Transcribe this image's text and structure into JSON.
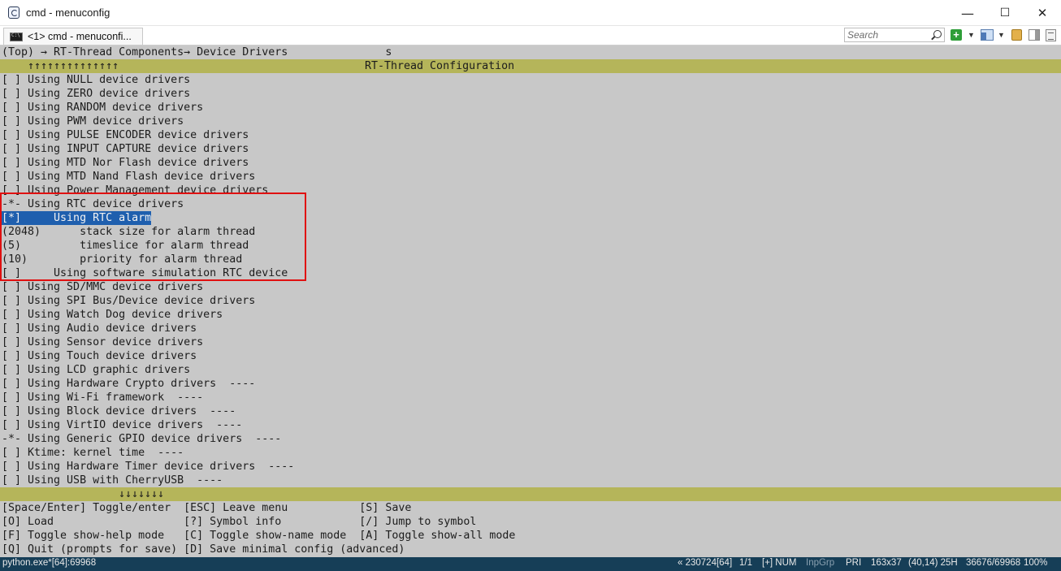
{
  "window": {
    "title": "cmd - menuconfig",
    "minimize": "—",
    "maximize": "☐",
    "close": "✕"
  },
  "tabbar": {
    "tab_label": "<1> cmd - menuconfi...",
    "search_placeholder": "Search"
  },
  "menuconfig": {
    "breadcrumb": "(Top) → RT-Thread Components→ Device Drivers               s",
    "top_arrows": "↑↑↑↑↑↑↑↑↑↑↑↑↑↑",
    "header_title": "RT-Thread Configuration",
    "items": [
      "[ ] Using NULL device drivers",
      "[ ] Using ZERO device drivers",
      "[ ] Using RANDOM device drivers",
      "[ ] Using PWM device drivers",
      "[ ] Using PULSE ENCODER device drivers",
      "[ ] Using INPUT CAPTURE device drivers",
      "[ ] Using MTD Nor Flash device drivers",
      "[ ] Using MTD Nand Flash device drivers",
      "[ ] Using Power Management device drivers",
      "-*- Using RTC device drivers",
      "[*]     Using RTC alarm",
      "(2048)      stack size for alarm thread",
      "(5)         timeslice for alarm thread",
      "(10)        priority for alarm thread",
      "[ ]     Using software simulation RTC device",
      "[ ] Using SD/MMC device drivers",
      "[ ] Using SPI Bus/Device device drivers",
      "[ ] Using Watch Dog device drivers",
      "[ ] Using Audio device drivers",
      "[ ] Using Sensor device drivers",
      "[ ] Using Touch device drivers",
      "[ ] Using LCD graphic drivers",
      "[ ] Using Hardware Crypto drivers  ----",
      "[ ] Using Wi-Fi framework  ----",
      "[ ] Using Block device drivers  ----",
      "[ ] Using VirtIO device drivers  ----",
      "-*- Using Generic GPIO device drivers  ----",
      "[ ] Ktime: kernel time  ----",
      "[ ] Using Hardware Timer device drivers  ----",
      "[ ] Using USB with CherryUSB  ----"
    ],
    "selected_index": 10,
    "bottom_arrows": "↓↓↓↓↓↓↓",
    "help_lines": [
      "[Space/Enter] Toggle/enter  [ESC] Leave menu           [S] Save",
      "[O] Load                    [?] Symbol info            [/] Jump to symbol",
      "[F] Toggle show-help mode   [C] Toggle show-name mode  [A] Toggle show-all mode",
      "[Q] Quit (prompts for save) [D] Save minimal config (advanced)"
    ]
  },
  "statusbar": {
    "process": "python.exe*[64]:69968",
    "position": "« 230724[64]",
    "page": "1/1",
    "mode": "[+] NUM",
    "inpgrp": "InpGrp",
    "priority": "PRI",
    "size": "163x37",
    "cursor": "(40,14) 25H",
    "buffer": "36676/69968",
    "zoom": "100%"
  },
  "colors": {
    "terminal_bg": "#c8c8c8",
    "header_bar": "#b5b55a",
    "selection": "#1f5fae",
    "highlight_box": "#e01010",
    "statusbar_bg": "#163e57"
  }
}
